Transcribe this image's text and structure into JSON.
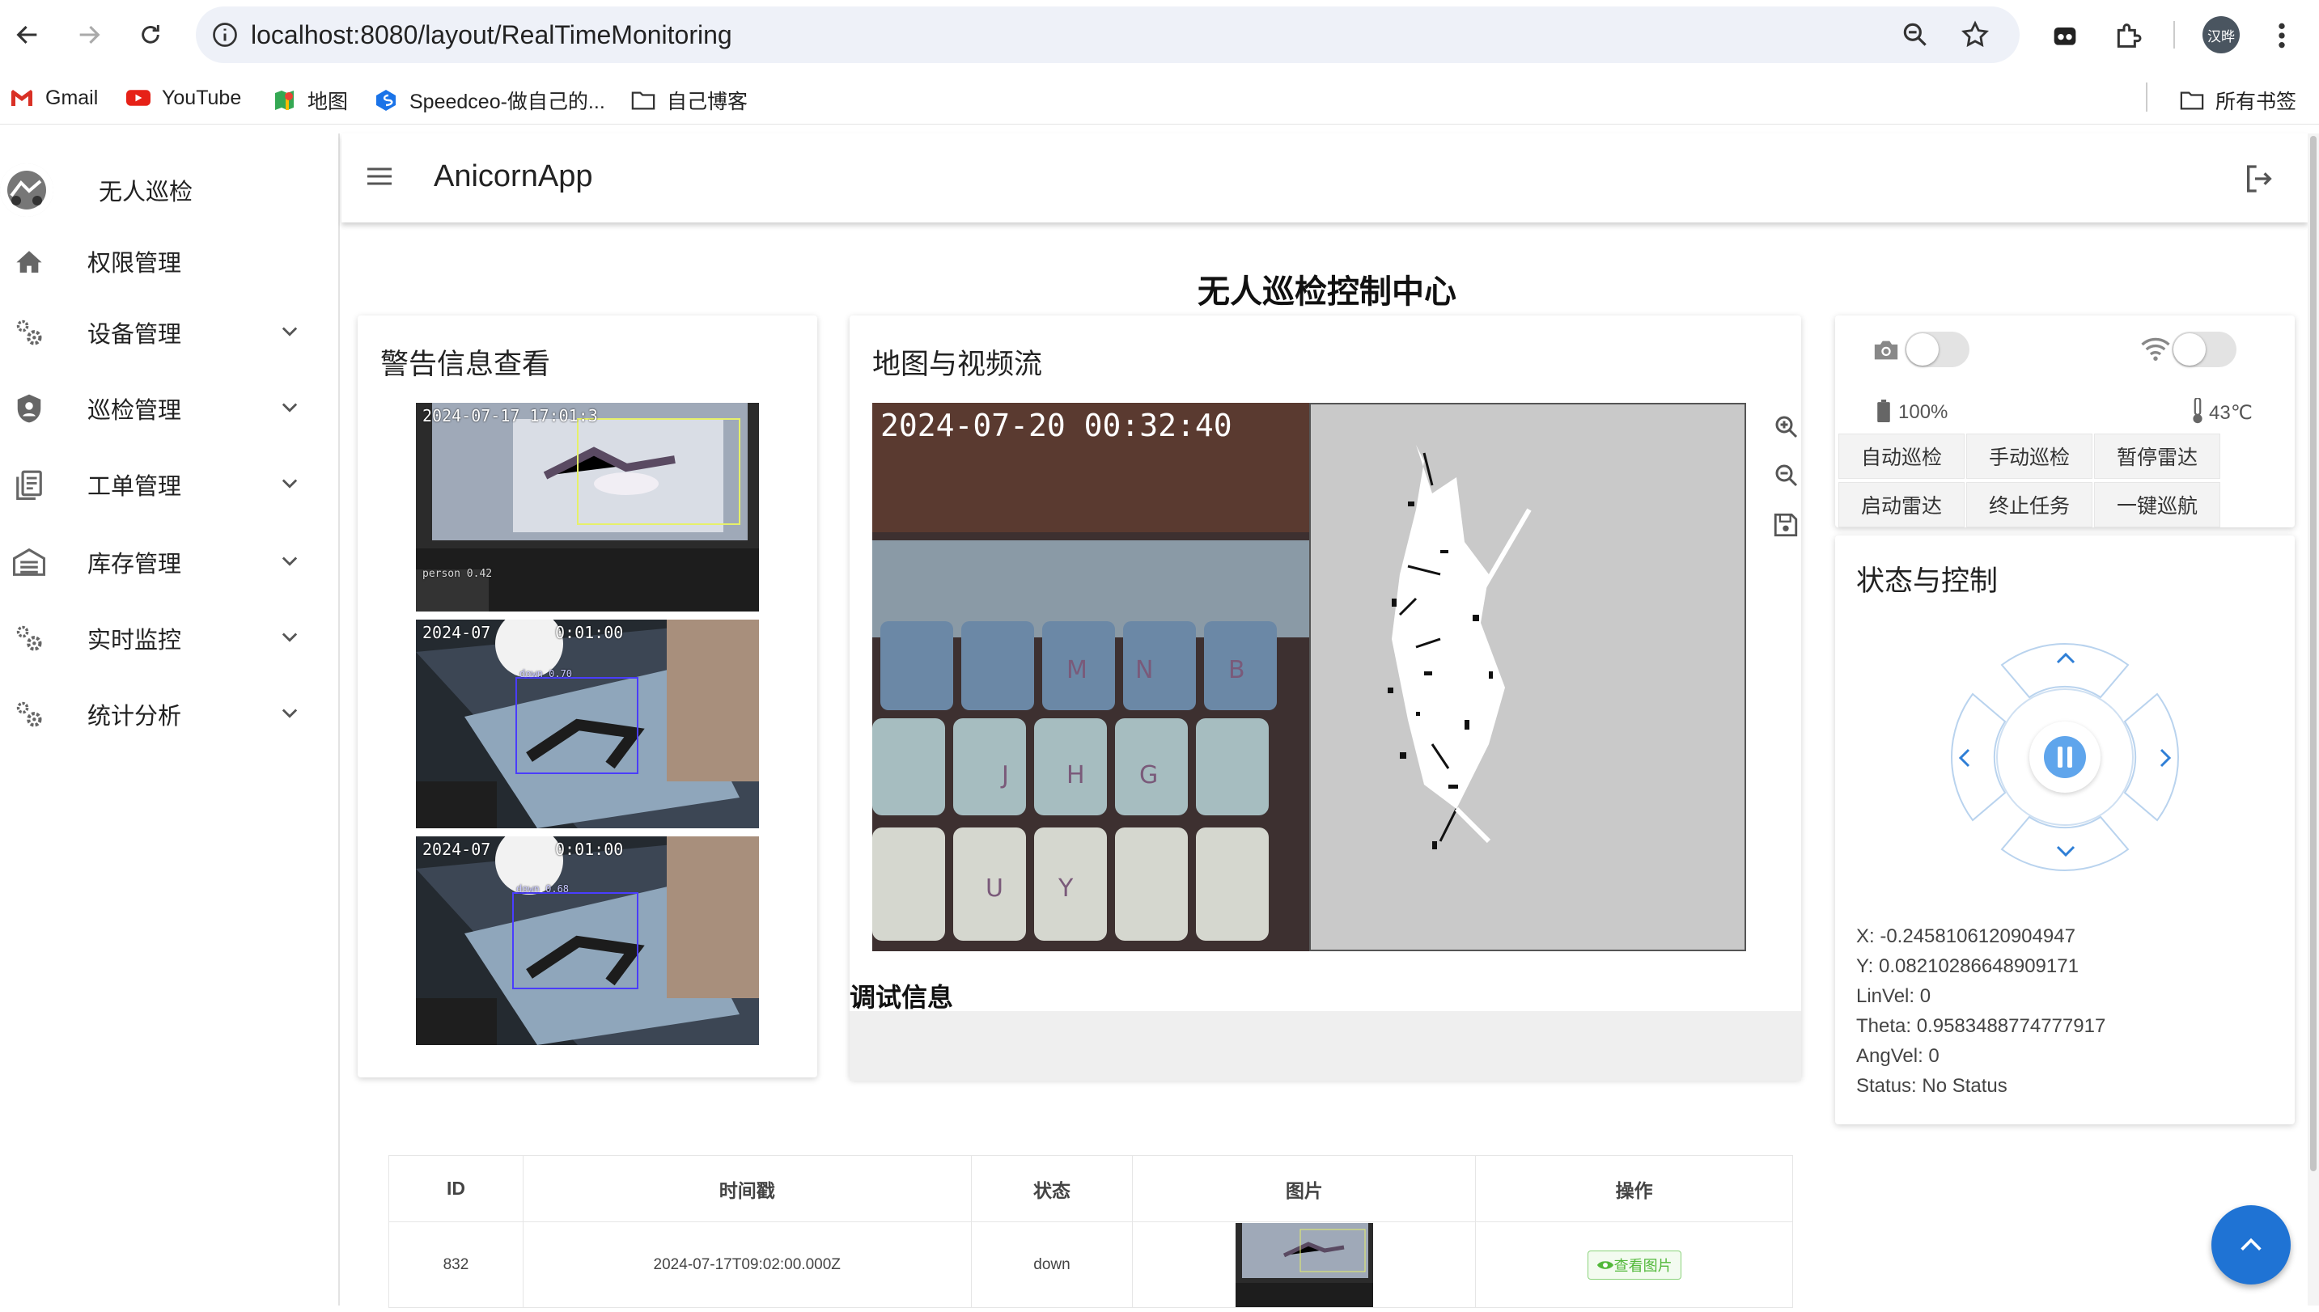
{
  "browser": {
    "url": "localhost:8080/layout/RealTimeMonitoring",
    "profile_label": "汉晔",
    "bookmarks": [
      {
        "label": "Gmail",
        "icon": "gmail-icon"
      },
      {
        "label": "YouTube",
        "icon": "youtube-icon"
      },
      {
        "label": "地图",
        "icon": "maps-icon"
      },
      {
        "label": "Speedceo-做自己的...",
        "icon": "speedceo-icon"
      },
      {
        "label": "自己博客",
        "icon": "folder-icon"
      }
    ],
    "all_bookmarks": "所有书签"
  },
  "sidebar": {
    "brand": "无人巡检",
    "items": [
      {
        "label": "权限管理",
        "icon": "home-icon",
        "expandable": false
      },
      {
        "label": "设备管理",
        "icon": "gears-icon",
        "expandable": true
      },
      {
        "label": "巡检管理",
        "icon": "shield-user-icon",
        "expandable": true
      },
      {
        "label": "工单管理",
        "icon": "clipboard-icon",
        "expandable": true
      },
      {
        "label": "库存管理",
        "icon": "warehouse-icon",
        "expandable": true
      },
      {
        "label": "实时监控",
        "icon": "gears-icon",
        "expandable": true
      },
      {
        "label": "统计分析",
        "icon": "gears-icon",
        "expandable": true
      }
    ]
  },
  "header": {
    "app_name": "AnicornApp"
  },
  "main": {
    "title": "无人巡检控制中心",
    "alerts": {
      "title": "警告信息查看",
      "images": [
        {
          "timestamp": "2024-07-17 17:01:3",
          "label": "person 0.42"
        },
        {
          "timestamp": "2024-07",
          "timestamp2": "0:01:00",
          "label": "down 0.70"
        },
        {
          "timestamp": "2024-07",
          "timestamp2": "0:01:00",
          "label": "down 0.68"
        }
      ]
    },
    "map_video": {
      "title": "地图与视频流",
      "video_timestamp": "2024-07-20 00:32:40"
    },
    "debug": {
      "title": "调试信息"
    },
    "control": {
      "battery": "100%",
      "temperature": "43℃",
      "buttons": [
        "自动巡检",
        "手动巡检",
        "暂停雷达",
        "启动雷达",
        "终止任务",
        "一键巡航"
      ],
      "status_title": "状态与控制",
      "stats": [
        "X: -0.2458106120904947",
        "Y: 0.08210286648909171",
        "LinVel: 0",
        "Theta: 0.9583488774777917",
        "AngVel: 0",
        "Status: No Status"
      ]
    },
    "table": {
      "headers": [
        "ID",
        "时间戳",
        "状态",
        "图片",
        "操作"
      ],
      "rows": [
        {
          "id": "832",
          "timestamp": "2024-07-17T09:02:00.000Z",
          "status": "down",
          "action": "查看图片"
        }
      ]
    }
  }
}
